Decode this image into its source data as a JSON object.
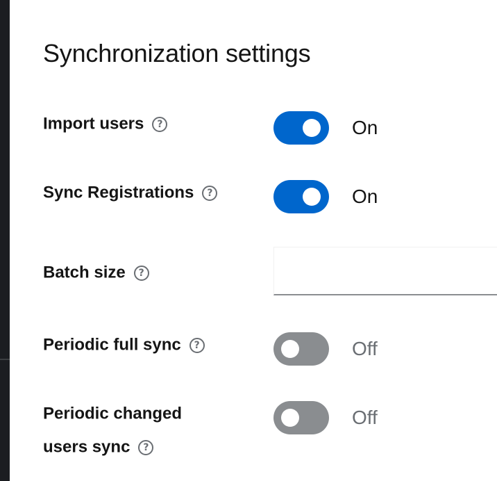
{
  "section": {
    "title": "Synchronization settings"
  },
  "fields": {
    "import_users": {
      "label": "Import users",
      "state_text": "On"
    },
    "sync_registrations": {
      "label": "Sync Registrations",
      "state_text": "On"
    },
    "batch_size": {
      "label": "Batch size",
      "value": "",
      "placeholder": ""
    },
    "periodic_full_sync": {
      "label": "Periodic full sync",
      "state_text": "Off"
    },
    "periodic_changed_users_sync": {
      "label_line1": "Periodic changed",
      "label_line2": "users sync",
      "state_text": "Off"
    }
  },
  "icons": {
    "help": "help-circle-icon"
  },
  "colors": {
    "switch_on": "#0066cc",
    "switch_off": "#8a8d90",
    "left_rail": "#1b1d21"
  }
}
